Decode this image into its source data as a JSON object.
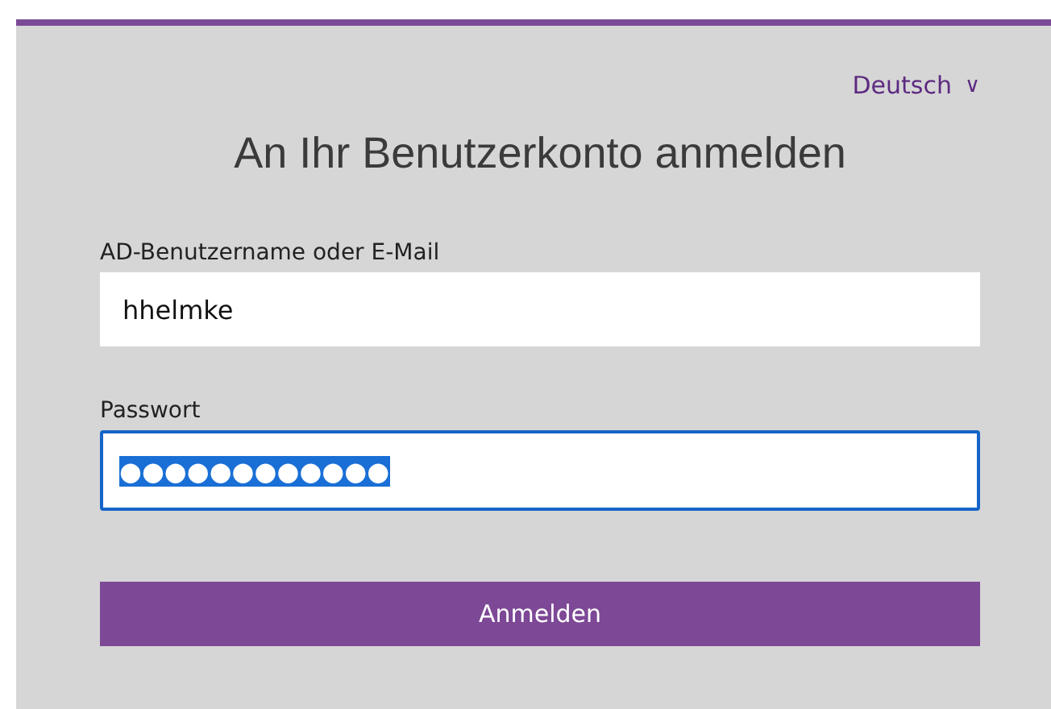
{
  "language": {
    "label": "Deutsch",
    "caret": "∨"
  },
  "title": "An Ihr Benutzerkonto anmelden",
  "fields": [
    {
      "label": "AD-Benutzername oder E-Mail",
      "value": "hhelmke",
      "focused": false,
      "text_selected": false
    },
    {
      "label": "Passwort",
      "value": "●●●●●●●●●●●●",
      "focused": true,
      "text_selected": true
    }
  ],
  "submit": "Anmelden"
}
